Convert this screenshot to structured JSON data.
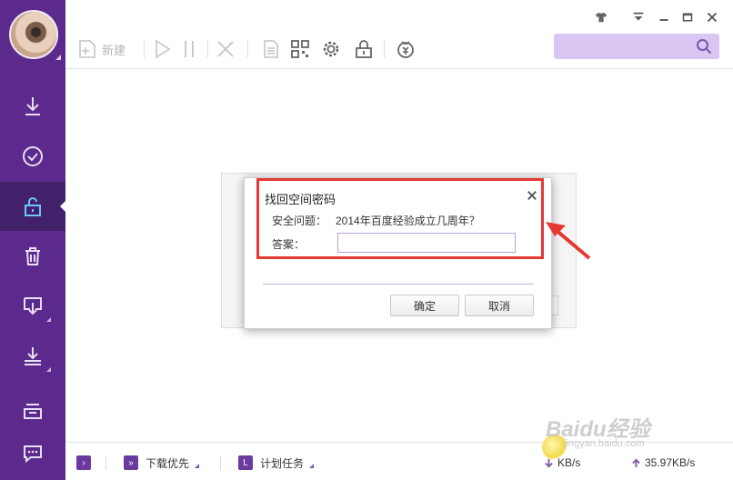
{
  "toolbar": {
    "new_label": "新建"
  },
  "search": {
    "placeholder": ""
  },
  "dialog": {
    "title": "找回空间密码",
    "question_label": "安全问题：",
    "question_text": "2014年百度经验成立几周年？",
    "answer_label": "答案：",
    "answer_value": "",
    "confirm_label": "确定",
    "cancel_label": "取消"
  },
  "statusbar": {
    "download_priority": "下载优先",
    "scheduled_tasks": "计划任务",
    "down_speed": "KB/s",
    "up_speed": "35.97KB/s"
  },
  "watermark": {
    "text": "Baidu经验",
    "sub": "jingyan.baidu.com"
  },
  "colors": {
    "sidebar": "#5b2a8c",
    "sidebar_active": "#43206a",
    "search_bg": "#d9c6f2",
    "highlight": "#e53935",
    "accent": "#6a3a9e"
  },
  "icons": [
    "download-icon",
    "check-icon",
    "unlock-icon",
    "trash-icon",
    "import-icon",
    "install-icon",
    "inbox-icon",
    "chat-icon",
    "shirt-icon",
    "dropdown-icon",
    "minimize-icon",
    "maximize-icon",
    "close-icon",
    "search-icon"
  ]
}
